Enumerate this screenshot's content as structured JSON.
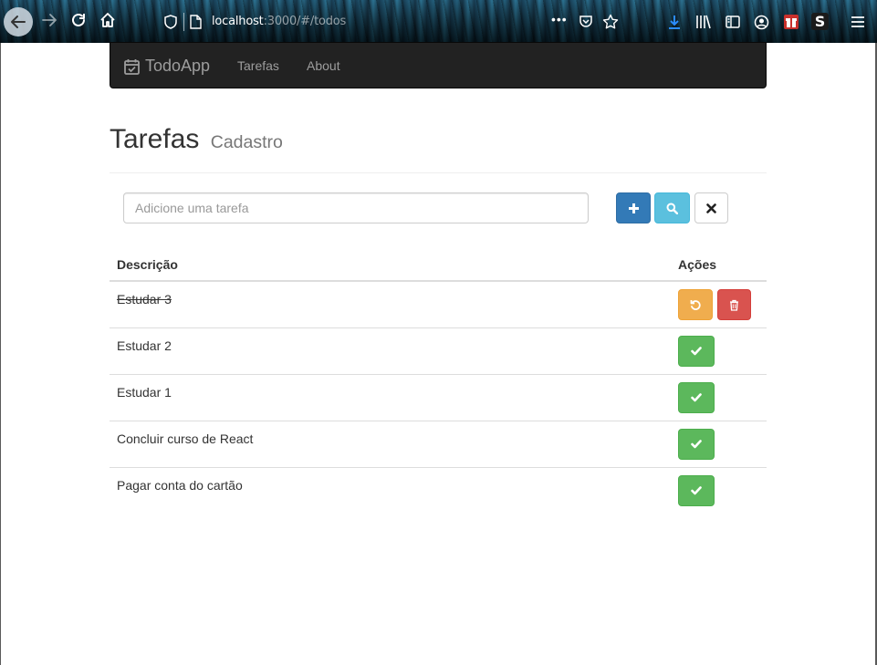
{
  "browser": {
    "url_host": "localhost",
    "url_rest": ":3000/#/todos"
  },
  "navbar": {
    "brand": "TodoApp",
    "links": [
      "Tarefas",
      "About"
    ]
  },
  "header": {
    "title": "Tarefas",
    "subtitle": "Cadastro"
  },
  "form": {
    "placeholder": "Adicione uma tarefa",
    "value": ""
  },
  "table": {
    "columns": [
      "Descrição",
      "Ações"
    ],
    "rows": [
      {
        "description": "Estudar 3",
        "done": true
      },
      {
        "description": "Estudar 2",
        "done": false
      },
      {
        "description": "Estudar 1",
        "done": false
      },
      {
        "description": "Concluir curso de React",
        "done": false
      },
      {
        "description": "Pagar conta do cartão",
        "done": false
      }
    ]
  },
  "icons": {
    "add_button": "plus-icon",
    "search_button": "search-icon",
    "clear_button": "close-icon",
    "done_button": "check-icon",
    "undo_button": "undo-icon",
    "delete_button": "trash-icon"
  },
  "colors": {
    "navbar_bg": "#222222",
    "primary": "#337ab7",
    "info": "#5bc0de",
    "success": "#5cb85c",
    "warning": "#f0ad4e",
    "danger": "#d9534f"
  }
}
